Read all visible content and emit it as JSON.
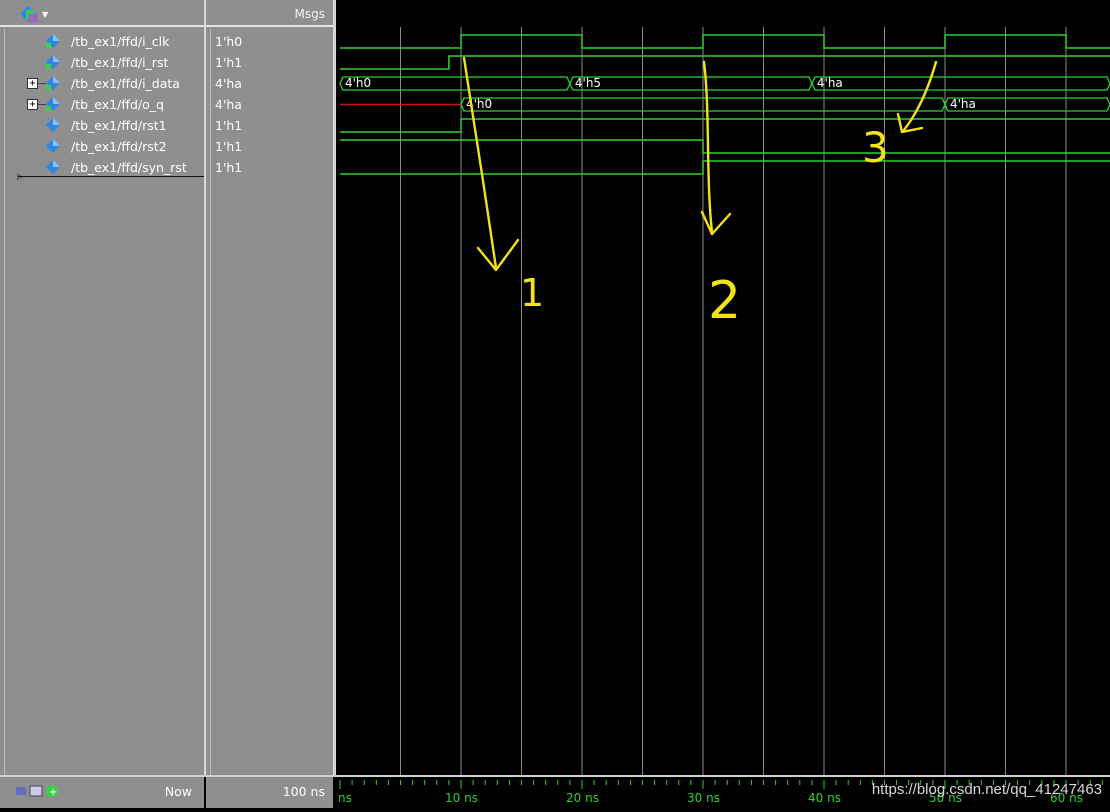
{
  "header": {
    "msgs_label": "Msgs"
  },
  "signals": [
    {
      "name": "/tb_ex1/ffd/i_clk",
      "value": "1'h0",
      "expandable": false
    },
    {
      "name": "/tb_ex1/ffd/i_rst",
      "value": "1'h1",
      "expandable": false
    },
    {
      "name": "/tb_ex1/ffd/i_data",
      "value": "4'ha",
      "expandable": true
    },
    {
      "name": "/tb_ex1/ffd/o_q",
      "value": "4'ha",
      "expandable": true
    },
    {
      "name": "/tb_ex1/ffd/rst1",
      "value": "1'h1",
      "expandable": false
    },
    {
      "name": "/tb_ex1/ffd/rst2",
      "value": "1'h1",
      "expandable": false
    },
    {
      "name": "/tb_ex1/ffd/syn_rst",
      "value": "1'h1",
      "expandable": false
    }
  ],
  "bus_labels": {
    "i_data": [
      "4'h0",
      "4'h5",
      "4'ha"
    ],
    "o_q": [
      "4'h0",
      "4'ha"
    ]
  },
  "bottom": {
    "now_label": "Now",
    "now_value": "100 ns"
  },
  "timeline": {
    "labels": [
      "ns",
      "10 ns",
      "20 ns",
      "30 ns",
      "40 ns",
      "50 ns",
      "60 ns"
    ]
  },
  "annotations": [
    "1",
    "2",
    "3"
  ],
  "watermark": "https://blog.csdn.net/qq_41247463",
  "colors": {
    "wave": "#2fd12f",
    "grid": "#8a8a8a",
    "undefined": "#d01010",
    "annotation": "#f2e21a",
    "icon_blue": "#2e86de",
    "icon_green": "#3bd14a"
  }
}
